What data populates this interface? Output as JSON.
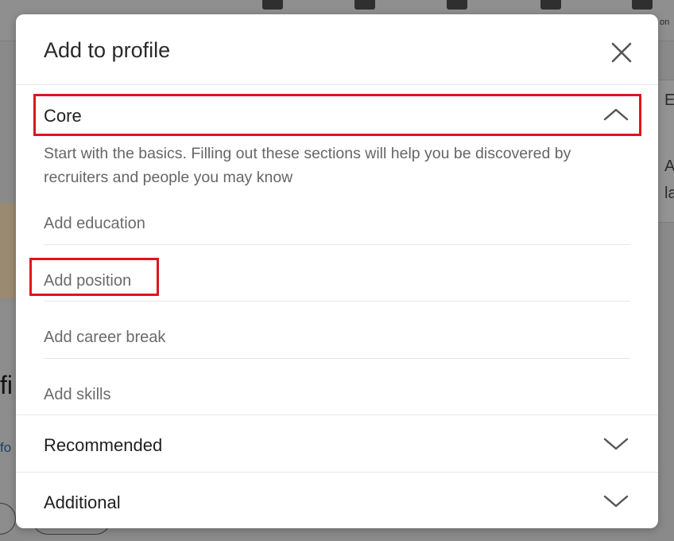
{
  "background": {
    "left_text_1": "fi",
    "left_text_2": "fo",
    "right_text_1": "E",
    "right_text_2": "A",
    "right_text_3": "la",
    "nav_partial": "on"
  },
  "modal": {
    "title": "Add to profile",
    "close_icon": "close-icon",
    "sections": {
      "core": {
        "label": "Core",
        "expanded": true,
        "description": "Start with the basics. Filling out these sections will help you be discovered by recruiters and people you may know",
        "items": [
          {
            "label": "Add education"
          },
          {
            "label": "Add position"
          },
          {
            "label": "Add career break"
          },
          {
            "label": "Add skills"
          }
        ]
      },
      "recommended": {
        "label": "Recommended",
        "expanded": false
      },
      "additional": {
        "label": "Additional",
        "expanded": false
      }
    }
  },
  "colors": {
    "highlight": "#e0141c",
    "overlay": "#8a8a8a"
  }
}
